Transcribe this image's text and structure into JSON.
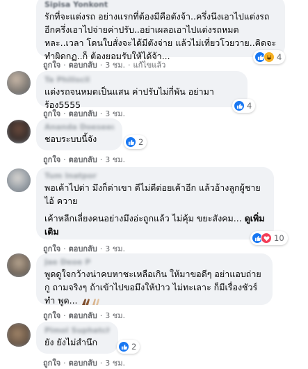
{
  "actions": {
    "like": "ถูกใจ",
    "reply": "ตอบกลับ",
    "sep": "·"
  },
  "comments": [
    {
      "author": "Sipisa Yonkont",
      "text": "รักที่จะแต่งรถ  อย่างแรกที่ต้องมีคือตังจ้า..ครึ่งนึงเอาไปแต่งรถ อีกครึ่งเอาไปจ่ายค่าปรับ..อย่าเผลอเอาไปแต่งรถหมดหละ..เวลา โดนใบสั่งจะได้มีตังจ่าย แล้วไม่เที่ยวโวยวาย..คิดจะทำผิดกฏ..ก็ ต้องยอมรับให้ได้จ้า...",
      "time": "3 ชม.",
      "edited": "แก้ไขแล้ว",
      "reaction_count": "4",
      "reactions": [
        "like",
        "haha"
      ]
    },
    {
      "author": "Ta Philiscil",
      "text": "แต่งรถจนหมดเป็นแสน ค่าปรับไม่กี่พัน อย่ามาร้อง5555",
      "time": "3 ชม.",
      "reaction_count": "4",
      "reactions": [
        "like"
      ]
    },
    {
      "author": "Ananda Doeseeu",
      "text": "ชอบระบบนี้จัง",
      "time": "3 ชม.",
      "reaction_count": "2",
      "reactions": [
        "like"
      ]
    },
    {
      "author": "Tum Inatpor",
      "text": "พอเค้าไปด่า มึงก็ด่าเขา ดีไม่ดีต่อยเค้าอีก แล้วอ้างลูกผู้ชาย ไอ้ ควาย",
      "text2": "เค้าหลีกเลี่ยงคนอย่างมึงอ่ะถูกแล้ว ไม่คุ้ม ขยะสังคม...",
      "see_more": "ดูเพิ่มเติม",
      "time": "3 ชม.",
      "reaction_count": "10",
      "reactions": [
        "like",
        "love"
      ]
    },
    {
      "author": "Jae Deoe P",
      "text": "พูดดูใจกว้างน่าคบหาชะเหลือเกิน ให้มาขอดีๆ อย่าแอบถ่าย กู ถามจริงๆ ถ้าเข้าไปขอมึงให้ป่าว ไม่ทะเลาะ ก็มีเรื่องชัวร์ ทำ พูด...",
      "time": "3 ชม.",
      "reaction_count": "2",
      "reactions": [
        "like"
      ]
    },
    {
      "author": "Pimol Suphatcha",
      "text": "ยัง ยังไม่สำนึก",
      "time": "3 ชม.",
      "reaction_count": "2",
      "reactions": [
        "like"
      ]
    }
  ]
}
